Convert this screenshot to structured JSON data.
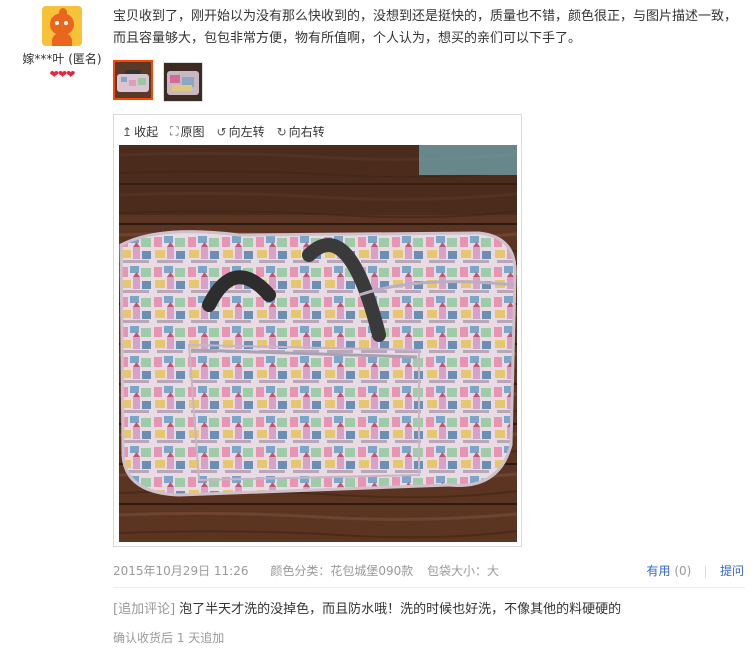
{
  "user": {
    "name": "嫁***叶 (匿名)",
    "hearts": "❤❤❤",
    "avatar_icon": "cartoon-mascot-icon"
  },
  "review": {
    "text": "宝贝收到了，刚开始以为没有那么快收到的，没想到还是挺快的，质量也不错，颜色很正，与图片描述一致，而且容量够大，包包非常方便，物有所值啊，个人认为，想买的亲们可以下手了。"
  },
  "viewer": {
    "collapse_label": "收起",
    "original_label": "原图",
    "rotate_left_label": "向左转",
    "rotate_right_label": "向右转"
  },
  "meta": {
    "date": "2015年10月29日 11:26",
    "color": "颜色分类：花包城堡090款",
    "size": "包袋大小：大"
  },
  "actions": {
    "useful_label": "有用",
    "useful_count": "(0)",
    "reply_label": "提问"
  },
  "append": {
    "tag": "[追加评论]",
    "text": "泡了半天才洗的没掉色，而且防水哦！洗的时候也好洗，不像其他的料硬硬的",
    "time": "确认收货后 1 天追加"
  },
  "colors": {
    "accent": "#ff4400",
    "link": "#3366cc",
    "muted": "#999999"
  }
}
